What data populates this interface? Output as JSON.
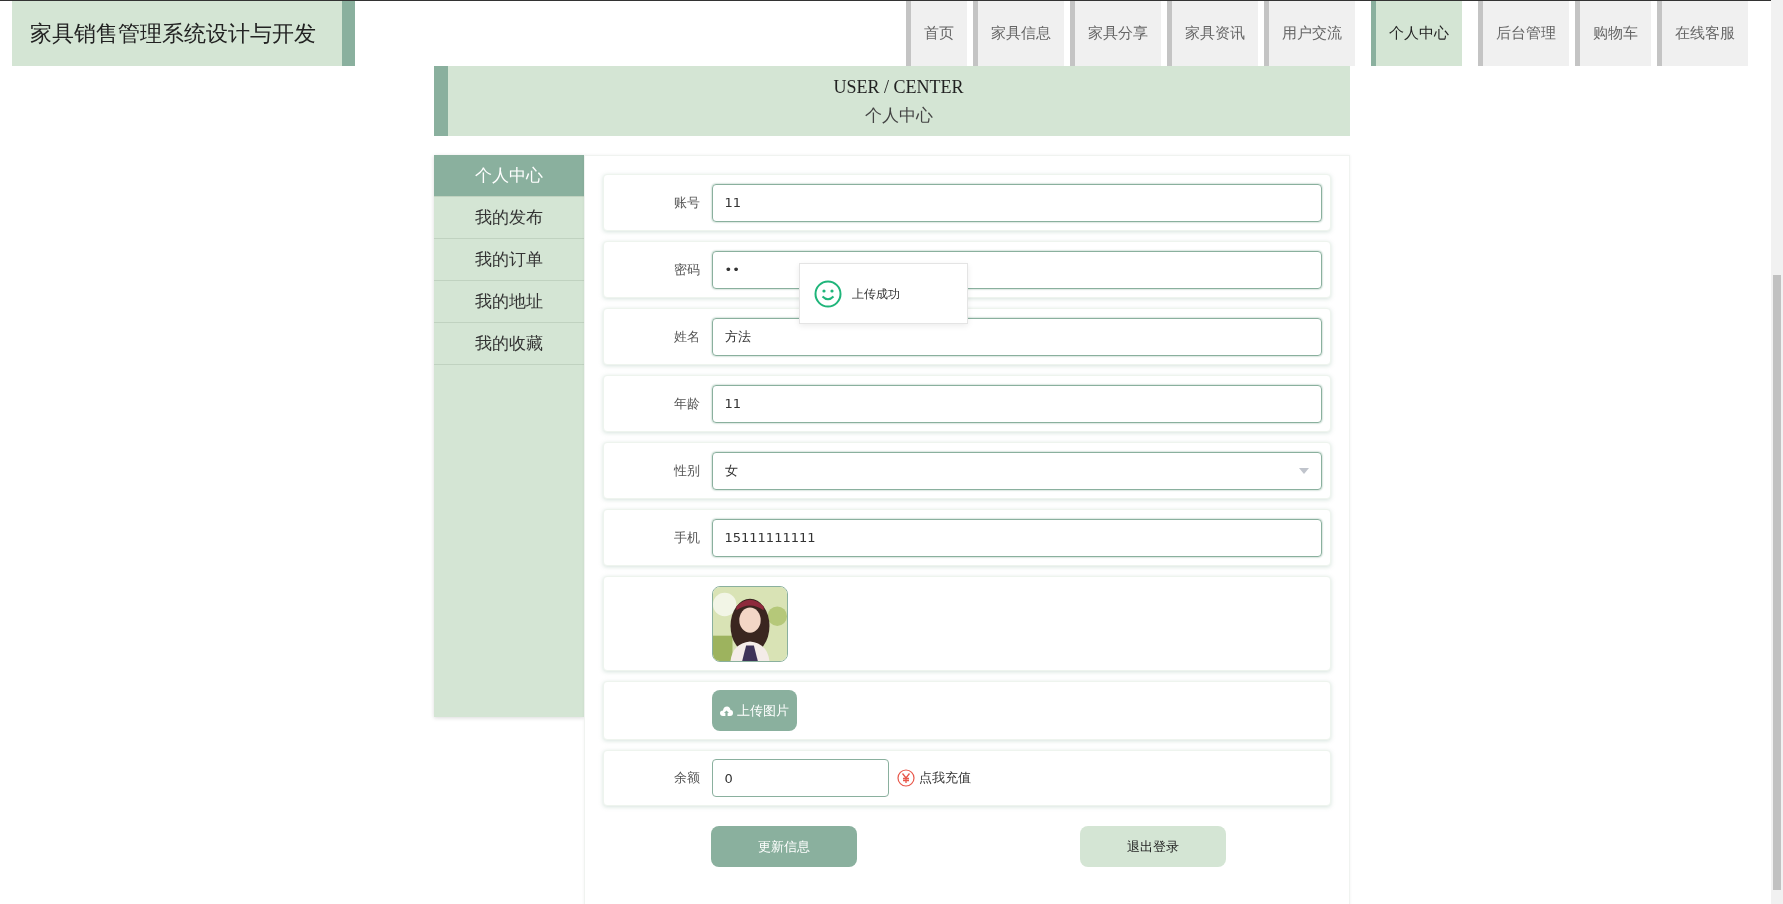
{
  "site_title": "家具销售管理系统设计与开发",
  "nav": [
    {
      "label": "首页",
      "selected": false
    },
    {
      "label": "家具信息",
      "selected": false
    },
    {
      "label": "家具分享",
      "selected": false
    },
    {
      "label": "家具资讯",
      "selected": false
    },
    {
      "label": "用户交流",
      "selected": false
    },
    {
      "label": "个人中心",
      "selected": true
    },
    {
      "label": "后台管理",
      "selected": false
    },
    {
      "label": "购物车",
      "selected": false
    },
    {
      "label": "在线客服",
      "selected": false
    }
  ],
  "banner": {
    "title_en": "USER / CENTER",
    "title": "个人中心"
  },
  "sidebar": {
    "items": [
      {
        "label": "个人中心",
        "selected": true
      },
      {
        "label": "我的发布",
        "selected": false
      },
      {
        "label": "我的订单",
        "selected": false
      },
      {
        "label": "我的地址",
        "selected": false
      },
      {
        "label": "我的收藏",
        "selected": false
      }
    ]
  },
  "form": {
    "rows": [
      {
        "kind": "input",
        "label": "账号",
        "value": "11"
      },
      {
        "kind": "password",
        "label": "密码",
        "value": "••"
      },
      {
        "kind": "input",
        "label": "姓名",
        "value": "方法"
      },
      {
        "kind": "input",
        "label": "年龄",
        "value": "11"
      },
      {
        "kind": "select",
        "label": "性别",
        "value": "女"
      },
      {
        "kind": "input",
        "label": "手机",
        "value": "15111111111"
      },
      {
        "kind": "picture"
      },
      {
        "kind": "upload",
        "button": "上传图片"
      },
      {
        "kind": "balance",
        "label": "余额",
        "value": "0",
        "link": "点我充值"
      }
    ],
    "buttons": [
      {
        "label": "更新信息",
        "kind": "primary"
      },
      {
        "label": "退出登录",
        "kind": "secondary"
      }
    ]
  },
  "toast": {
    "message": "上传成功"
  }
}
